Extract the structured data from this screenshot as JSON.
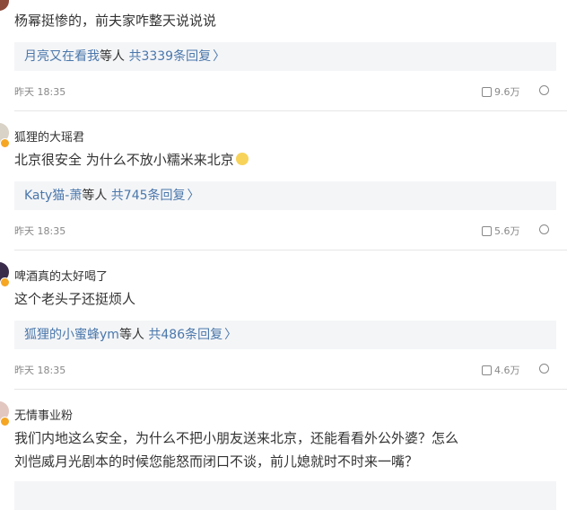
{
  "comments": [
    {
      "username": "",
      "content": "杨幂挺惨的，前夫家咋整天说说说",
      "reply": {
        "users": "月亮又在看我",
        "deng": "等人",
        "total": "共3339条回复",
        "chev": "〉"
      },
      "time": "昨天 18:35",
      "likes": "9.6万"
    },
    {
      "username": "狐狸的大瑶君",
      "content": "北京很安全 为什么不放小糯米来北京",
      "reply": {
        "users": "Katy猫-萧",
        "deng": "等人",
        "total": "共745条回复",
        "chev": "〉"
      },
      "time": "昨天 18:35",
      "likes": "5.6万"
    },
    {
      "username": "啤酒真的太好喝了",
      "content": "这个老头子还挺烦人",
      "reply": {
        "users": "狐狸的小蜜蜂ym",
        "deng": "等人",
        "total": "共486条回复",
        "chev": "〉"
      },
      "time": "昨天 18:35",
      "likes": "4.6万"
    },
    {
      "username": "无情事业粉",
      "content_line1": "我们内地这么安全，为什么不把小朋友送来北京，还能看看外公外婆？怎么",
      "content_line2": "刘恺威月光剧本的时候您能怒而闭口不谈，前儿媳就时不时来一嘴？"
    }
  ]
}
